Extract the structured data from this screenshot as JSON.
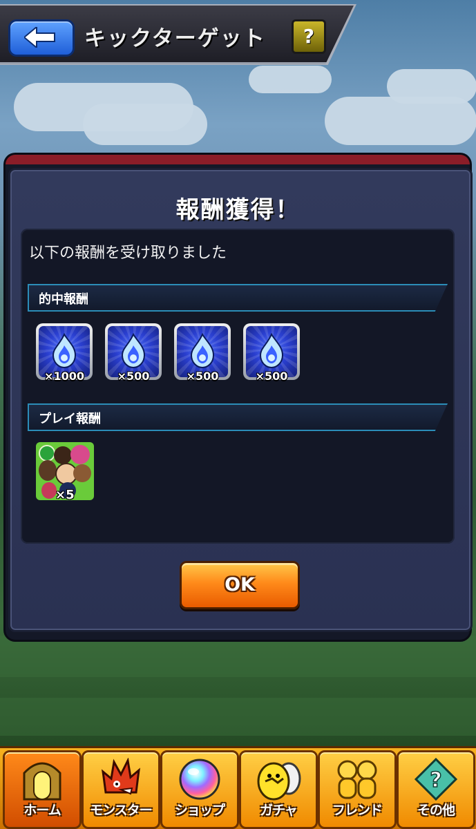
{
  "header": {
    "title": "キックターゲット",
    "help_label": "?"
  },
  "dialog": {
    "title": "報酬獲得！",
    "message": "以下の報酬を受け取りました",
    "sections": {
      "hit_reward": {
        "label": "的中報酬",
        "items": [
          {
            "icon": "blue-flame-orb-icon",
            "quantity": "×1000"
          },
          {
            "icon": "blue-flame-orb-icon",
            "quantity": "×500"
          },
          {
            "icon": "blue-flame-orb-icon",
            "quantity": "×500"
          },
          {
            "icon": "blue-flame-orb-icon",
            "quantity": "×500"
          }
        ]
      },
      "play_reward": {
        "label": "プレイ報酬",
        "items": [
          {
            "icon": "character-group-icon",
            "quantity": "×5"
          }
        ]
      }
    },
    "ok_label": "OK"
  },
  "nav": {
    "items": [
      {
        "label": "ホーム",
        "icon": "home-gate-icon",
        "active": true
      },
      {
        "label": "モンスター",
        "icon": "monster-icon",
        "active": false
      },
      {
        "label": "ショップ",
        "icon": "rainbow-orb-icon",
        "active": false
      },
      {
        "label": "ガチャ",
        "icon": "egg-icon",
        "active": false
      },
      {
        "label": "フレンド",
        "icon": "friends-icon",
        "active": false
      },
      {
        "label": "その他",
        "icon": "other-icon",
        "active": false
      }
    ]
  },
  "colors": {
    "dialog_panel": "#2a3152",
    "section_border": "#2b8db8",
    "ok_button": "#ff8a1a",
    "nav_bar": "#f7b21e"
  }
}
